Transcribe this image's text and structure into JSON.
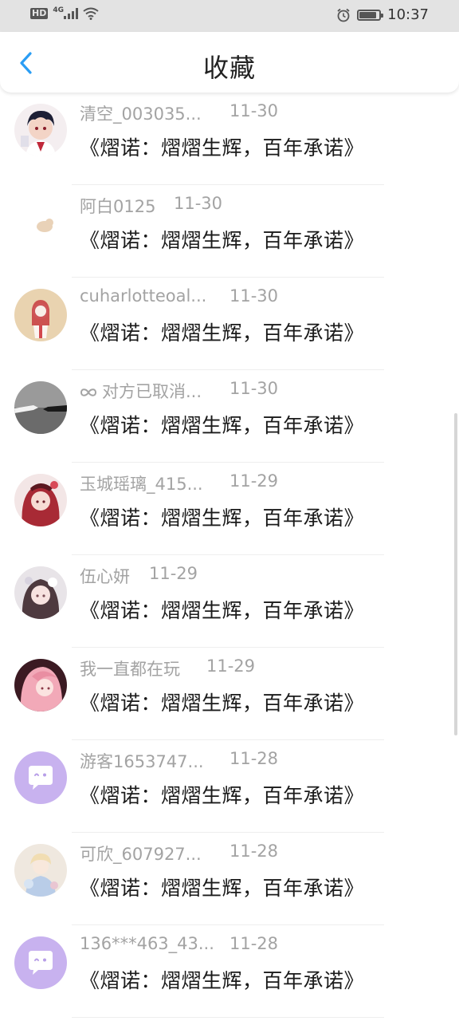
{
  "status_bar": {
    "hd": "HD",
    "network": "4G",
    "time": "10:37",
    "battery_level": 0.85
  },
  "header": {
    "title": "收藏"
  },
  "items": [
    {
      "name": "清空_003035...",
      "date": "11-30",
      "book": "《熠诺：熠熠生辉，百年承诺》",
      "avatar": "anime-boy",
      "date_pos": "long"
    },
    {
      "name": "阿白0125",
      "date": "11-30",
      "book": "《熠诺：熠熠生辉，百年承诺》",
      "avatar": "moon-cat",
      "date_pos": "short"
    },
    {
      "name": "cuharlotteoal...",
      "date": "11-30",
      "book": "《熠诺：熠熠生辉，百年承诺》",
      "avatar": "red-girl",
      "date_pos": "long"
    },
    {
      "name": "对方已取消...",
      "date": "11-30",
      "book": "《熠诺：熠熠生辉，百年承诺》",
      "avatar": "hands-gray",
      "prefix_icon": "infinity-icon",
      "date_pos": "long"
    },
    {
      "name": "玉城瑶璃_415...",
      "date": "11-29",
      "book": "《熠诺：熠熠生辉，百年承诺》",
      "avatar": "red-hair",
      "date_pos": "long"
    },
    {
      "name": "伍心妍",
      "date": "11-29",
      "book": "《熠诺：熠熠生辉，百年承诺》",
      "avatar": "flower-girl",
      "date_pos": "xshort"
    },
    {
      "name": "我一直都在玩",
      "date": "11-29",
      "book": "《熠诺：熠熠生辉，百年承诺》",
      "avatar": "pink-hair",
      "date_pos": "mid"
    },
    {
      "name": "游客1653747...",
      "date": "11-28",
      "book": "《熠诺：熠熠生辉，百年承诺》",
      "avatar": "chat-bubble",
      "date_pos": "long"
    },
    {
      "name": "可欣_607927...",
      "date": "11-28",
      "book": "《熠诺：熠熠生辉，百年承诺》",
      "avatar": "doll",
      "date_pos": "long"
    },
    {
      "name": "136***463_43...",
      "date": "11-28",
      "book": "《熠诺：熠熠生辉，百年承诺》",
      "avatar": "chat-bubble",
      "date_pos": "long"
    }
  ],
  "colors": {
    "accent": "#2a9df4",
    "name_gray": "#a3a3a3",
    "avatar_purple": "#c8b2ef"
  }
}
